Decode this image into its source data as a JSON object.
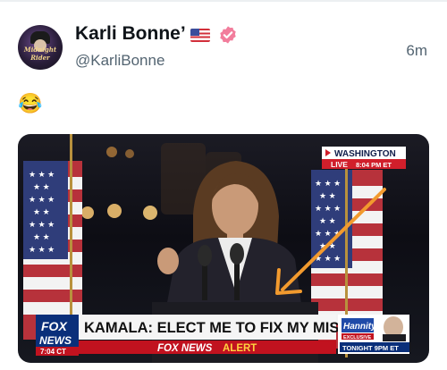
{
  "post": {
    "author": {
      "display_name": "Karli Bonne’",
      "handle": "@KarliBonne",
      "flag_emoji": "🇺🇸",
      "verified": true,
      "badge_color": "#f4a3b8",
      "avatar_text": "Midnight Rider"
    },
    "timestamp": "6m",
    "text": "😂"
  },
  "media": {
    "location_label": "WASHINGTON",
    "live_label": "LIVE",
    "time_label": "8:04 PM ET",
    "channel": "FOX NEWS",
    "clock": "7:04 CT",
    "headline": "KAMALA: ELECT ME TO FIX MY MISTAKES",
    "alert_prefix": "FOX NEWS",
    "alert_word": "ALERT",
    "promo_show": "Hannity",
    "promo_line1": "EXCLUSIVE",
    "promo_line2": "TONIGHT 9PM ET",
    "arrow_color": "#f29a2e"
  }
}
